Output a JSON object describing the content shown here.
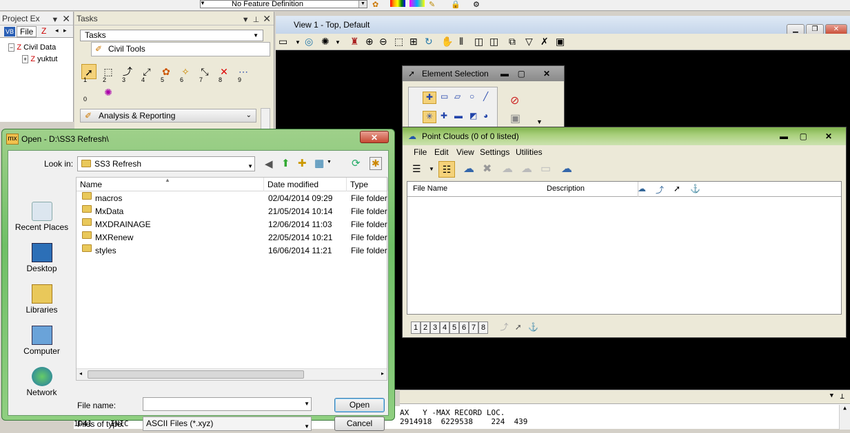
{
  "toolbar_top": {
    "feature_def": "No Feature Definition"
  },
  "project_explorer": {
    "title": "Project Ex",
    "tab": "File",
    "tree": [
      {
        "label": "Civil Data"
      },
      {
        "label": "yuktut"
      }
    ]
  },
  "tasks": {
    "title": "Tasks",
    "combo": "Tasks",
    "civil_tools": "Civil Tools",
    "tool_numbers": [
      "1",
      "2",
      "3",
      "4",
      "5",
      "6",
      "7",
      "8",
      "9",
      "0"
    ],
    "analysis": "Analysis & Reporting"
  },
  "view": {
    "title": "View 1 - Top, Default"
  },
  "element_selection": {
    "title": "Element Selection"
  },
  "point_clouds": {
    "title": "Point Clouds (0 of 0 listed)",
    "menu": [
      "File",
      "Edit",
      "View",
      "Settings",
      "Utilities"
    ],
    "columns": [
      "File Name",
      "Description"
    ],
    "footer_numbers": [
      "1",
      "2",
      "3",
      "4",
      "5",
      "6",
      "7",
      "8"
    ]
  },
  "output": {
    "line_right": "AX   Y -MAX RECORD LOC.",
    "line_right2": "2914918  6229538    224  439",
    "line_left": "1D41    INIC    7703    139   2914309  6229426"
  },
  "open_dialog": {
    "title": "Open - D:\\SS3 Refresh\\",
    "look_in_label": "Look in:",
    "look_in_value": "SS3 Refresh",
    "places": [
      "Recent Places",
      "Desktop",
      "Libraries",
      "Computer",
      "Network"
    ],
    "columns": {
      "name": "Name",
      "date": "Date modified",
      "type": "Type"
    },
    "files": [
      {
        "name": "macros",
        "date": "02/04/2014 09:29",
        "type": "File folder"
      },
      {
        "name": "MxData",
        "date": "21/05/2014 10:14",
        "type": "File folder"
      },
      {
        "name": "MXDRAINAGE",
        "date": "12/06/2014 11:03",
        "type": "File folder"
      },
      {
        "name": "MXRenew",
        "date": "22/05/2014 10:21",
        "type": "File folder"
      },
      {
        "name": "styles",
        "date": "16/06/2014 11:21",
        "type": "File folder"
      }
    ],
    "file_name_label": "File name:",
    "file_name_value": "",
    "files_of_type_label": "Files of type:",
    "files_of_type_value": "ASCII Files (*.xyz)",
    "open_label": "Open",
    "cancel_label": "Cancel"
  }
}
